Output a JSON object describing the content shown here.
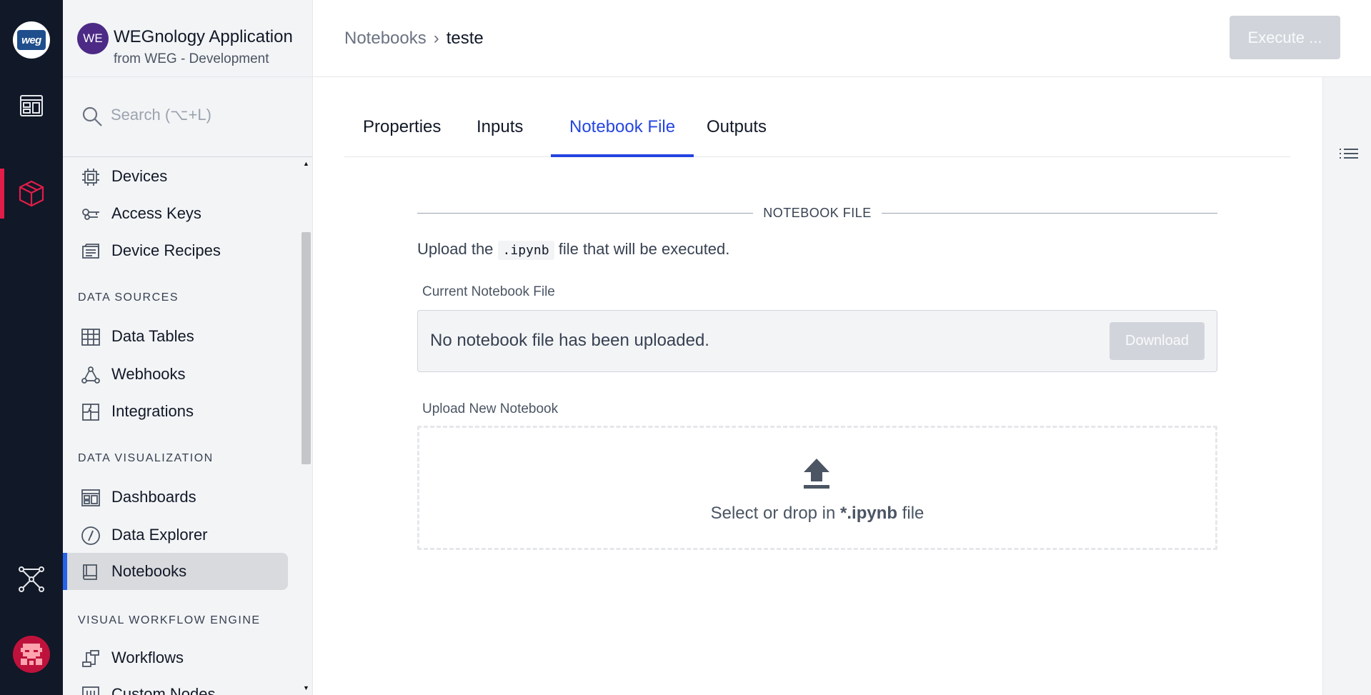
{
  "app": {
    "badge": "WE",
    "title": "WEGnology Application",
    "subtitle": "from WEG - Development",
    "logo_text": "weg"
  },
  "rail": {
    "items": [
      "dashboard-icon",
      "cube-icon",
      "network-icon"
    ],
    "accent": "#e11d48"
  },
  "search": {
    "placeholder": "Search (⌥+L)"
  },
  "sidebar": {
    "items": [
      {
        "label": "Devices",
        "icon": "chip-icon"
      },
      {
        "label": "Access Keys",
        "icon": "keys-icon"
      },
      {
        "label": "Device Recipes",
        "icon": "recipe-icon"
      }
    ],
    "data_sources_heading": "DATA SOURCES",
    "data_sources": [
      {
        "label": "Data Tables",
        "icon": "table-icon"
      },
      {
        "label": "Webhooks",
        "icon": "webhook-icon"
      },
      {
        "label": "Integrations",
        "icon": "puzzle-icon"
      }
    ],
    "data_viz_heading": "DATA VISUALIZATION",
    "data_viz": [
      {
        "label": "Dashboards",
        "icon": "dashboard-icon"
      },
      {
        "label": "Data Explorer",
        "icon": "compass-icon"
      },
      {
        "label": "Notebooks",
        "icon": "book-icon"
      }
    ],
    "vwe_heading": "VISUAL WORKFLOW ENGINE",
    "vwe": [
      {
        "label": "Workflows",
        "icon": "workflow-icon"
      },
      {
        "label": "Custom Nodes",
        "icon": "custom-nodes-icon"
      }
    ]
  },
  "breadcrumb": {
    "parent": "Notebooks",
    "separator": "›",
    "current": "teste"
  },
  "header": {
    "execute_label": "Execute ..."
  },
  "tabs": [
    "Properties",
    "Inputs",
    "Notebook File",
    "Outputs"
  ],
  "active_tab": "Notebook File",
  "section": {
    "title": "NOTEBOOK FILE",
    "intro_before": "Upload the",
    "intro_code": ".ipynb",
    "intro_after": "file that will be executed.",
    "current_label": "Current Notebook File",
    "current_value": "No notebook file has been uploaded.",
    "download_label": "Download",
    "upload_label": "Upload New Notebook",
    "drop_before": "Select or drop in",
    "drop_ext": "*.ipynb",
    "drop_after": "file"
  },
  "colors": {
    "rail_bg": "#111827",
    "active_tab": "#2545e0",
    "active_nav_bar": "#2563eb",
    "app_badge": "#4c2a85"
  }
}
